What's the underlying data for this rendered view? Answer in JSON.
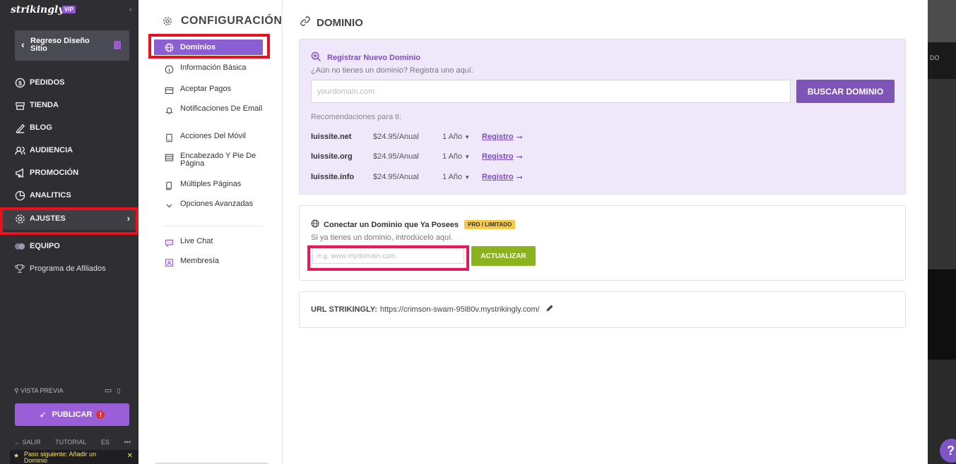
{
  "sidebar": {
    "brand": "strikingly",
    "vip": "VIP",
    "back_label": "Regreso Diseño Sitio",
    "items": [
      {
        "label": "PEDIDOS",
        "icon": "dollar-circle-icon"
      },
      {
        "label": "TIENDA",
        "icon": "store-icon"
      },
      {
        "label": "BLOG",
        "icon": "pen-icon"
      },
      {
        "label": "AUDIENCIA",
        "icon": "users-icon"
      },
      {
        "label": "PROMOCIÓN",
        "icon": "megaphone-icon"
      },
      {
        "label": "ANALITICS",
        "icon": "pie-chart-icon"
      },
      {
        "label": "AJUSTES",
        "icon": "gear-icon"
      },
      {
        "label": "EQUIPO",
        "icon": "team-icon"
      },
      {
        "label": "Programa de Afiliados",
        "icon": "trophy-icon"
      }
    ],
    "preview_label": "VISTA PREVIA",
    "publish_label": "PUBLICAR",
    "publish_badge": "!",
    "exit_label": "SALIR",
    "tutorial_label": "TUTORIAL",
    "lang_label": "ES",
    "more_label": "•••",
    "next_step": "Paso siguiente: Añadir un Dominio"
  },
  "settings": {
    "title": "CONFIGURACIÓN",
    "items": [
      {
        "label": "Dominios",
        "icon": "globe-icon"
      },
      {
        "label": "Información Básica",
        "icon": "info-icon"
      },
      {
        "label": "Aceptar Pagos",
        "icon": "card-icon"
      },
      {
        "label": "Notificaciones De Email",
        "icon": "bell-icon"
      },
      {
        "label": "Acciones Del Móvil",
        "icon": "mobile-icon"
      },
      {
        "label": "Encabezado Y Pie De Página",
        "icon": "layout-icon"
      },
      {
        "label": "Múltiples Páginas",
        "icon": "pages-icon"
      },
      {
        "label": "Opciones Avanzadas",
        "icon": "chevron-down-icon"
      },
      {
        "label": "Live Chat",
        "icon": "chat-icon"
      },
      {
        "label": "Membresía",
        "icon": "member-icon"
      }
    ]
  },
  "main": {
    "title": "DOMINIO",
    "register": {
      "title": "Registrar Nuevo Dominio",
      "subtitle": "¿Aún no tienes un dominio? Registra uno aquí.",
      "placeholder": "yourdomain.com",
      "button": "BUSCAR DOMINIO",
      "rec_label": "Recomendaciones para ti:",
      "recommendations": [
        {
          "domain": "luissite.net",
          "price": "$24.95/Anual",
          "years": "1 Año",
          "link": "Registro"
        },
        {
          "domain": "luissite.org",
          "price": "$24.95/Anual",
          "years": "1 Año",
          "link": "Registro"
        },
        {
          "domain": "luissite.info",
          "price": "$24.95/Anual",
          "years": "1 Año",
          "link": "Registro"
        }
      ]
    },
    "connect": {
      "title": "Conectar un Dominio que Ya Posees",
      "badge": "PRO / LIMITADO",
      "subtitle": "Si ya tienes un dominio, introdúcelo aquí.",
      "placeholder": "e.g. www.mydomain.com",
      "button": "ACTUALIZAR"
    },
    "url": {
      "label": "URL STRIKINGLY:",
      "value": "https://crimson-swam-95l80v.mystrikingly.com/"
    }
  },
  "preview_strip": {
    "bar_text": "DO",
    "help": "?"
  },
  "colors": {
    "sidebar_bg": "#2e2e33",
    "accent_purple": "#7e55b6",
    "selected_purple": "#8b5ed3",
    "green": "#8ab31f",
    "highlight_red": "#e8111d"
  }
}
